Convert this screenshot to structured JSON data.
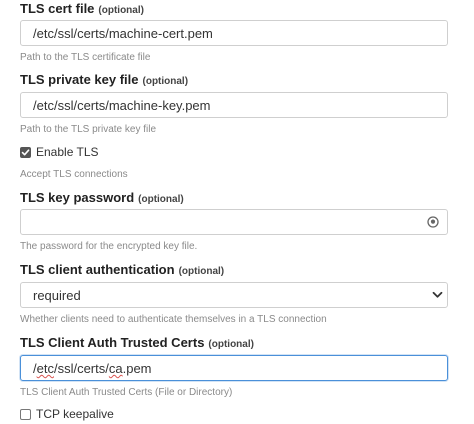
{
  "tls_cert_file": {
    "label": "TLS cert file",
    "optional": "(optional)",
    "value": "/etc/ssl/certs/machine-cert.pem",
    "help": "Path to the TLS certificate file"
  },
  "tls_private_key_file": {
    "label": "TLS private key file",
    "optional": "(optional)",
    "value": "/etc/ssl/certs/machine-key.pem",
    "help": "Path to the TLS private key file"
  },
  "enable_tls": {
    "label": "Enable TLS",
    "checked": true,
    "help": "Accept TLS connections"
  },
  "tls_key_password": {
    "label": "TLS key password",
    "optional": "(optional)",
    "value": "",
    "icon": "eye-icon",
    "help": "The password for the encrypted key file."
  },
  "tls_client_authentication": {
    "label": "TLS client authentication",
    "optional": "(optional)",
    "selected": "required",
    "help": "Whether clients need to authenticate themselves in a TLS connection"
  },
  "tls_client_auth_trusted_certs": {
    "label": "TLS Client Auth Trusted Certs",
    "optional": "(optional)",
    "value_prefix": "/",
    "value_etc": "etc",
    "value_mid": "/ssl/certs/",
    "value_ca": "ca",
    "value_suffix": ".pem",
    "help": "TLS Client Auth Trusted Certs (File or Directory)"
  },
  "tcp_keepalive": {
    "label": "TCP keepalive",
    "checked": false
  }
}
